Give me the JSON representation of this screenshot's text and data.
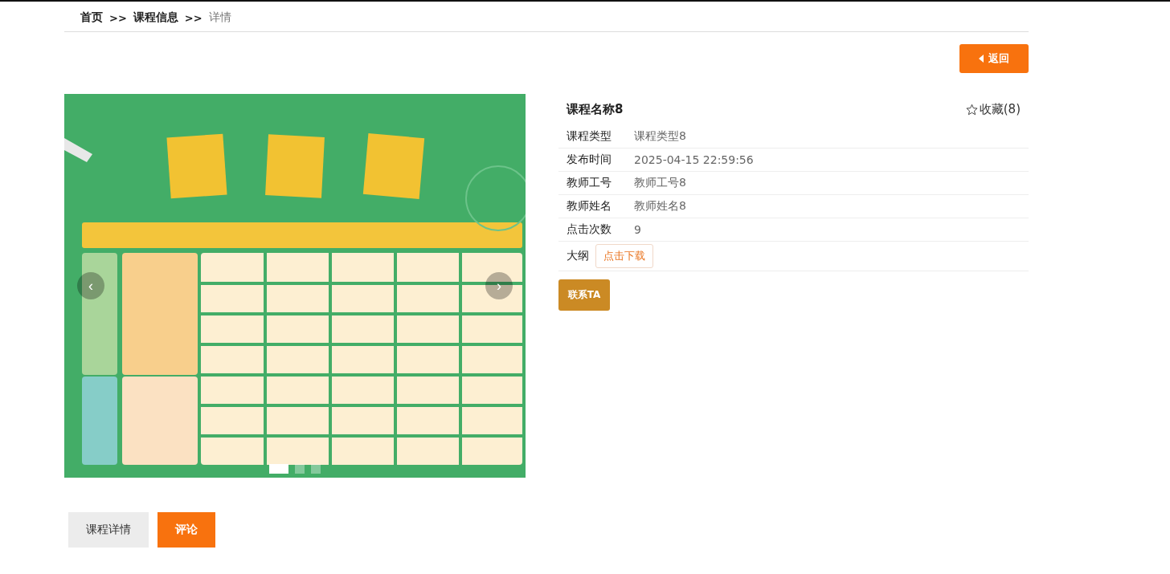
{
  "breadcrumb": [
    {
      "label": "首页",
      "current": false
    },
    {
      "label": ">>",
      "kind": "separator"
    },
    {
      "label": "课程信息",
      "current": false
    },
    {
      "label": ">>",
      "kind": "separator"
    },
    {
      "label": "详情",
      "current": true
    }
  ],
  "back_button": {
    "label": "返回"
  },
  "carousel": {
    "dots": [
      {
        "selected": true
      },
      {
        "selected": false
      },
      {
        "selected": false
      }
    ],
    "prev": "‹",
    "next": "›"
  },
  "detail": {
    "title": "课程名称8",
    "favorite": {
      "label": "收藏(8)"
    },
    "fields": [
      {
        "label": "课程类型",
        "value": "课程类型8"
      },
      {
        "label": "发布时间",
        "value": "2025-04-15 22:59:56"
      },
      {
        "label": "教师工号",
        "value": "教师工号8"
      },
      {
        "label": "教师姓名",
        "value": "教师姓名8"
      },
      {
        "label": "点击次数",
        "value": "9"
      }
    ],
    "syllabus": {
      "label": "大纲",
      "link": "点击下载"
    },
    "contact_button": "联系TA"
  },
  "tabs": [
    {
      "label": "课程详情",
      "selected": false
    },
    {
      "label": "评论",
      "selected": true
    }
  ]
}
